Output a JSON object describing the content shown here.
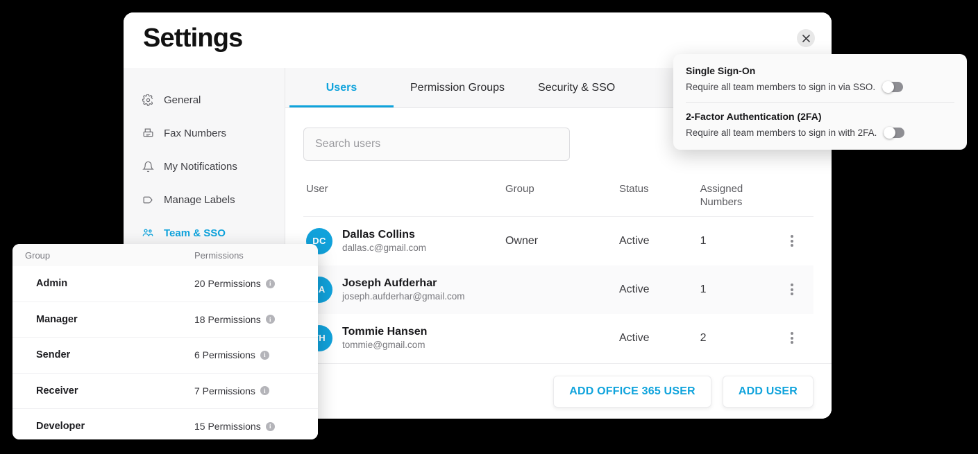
{
  "window": {
    "title": "Settings",
    "close_icon": "close-icon"
  },
  "sidebar": {
    "items": [
      {
        "label": "General",
        "icon": "gear-icon",
        "active": false
      },
      {
        "label": "Fax Numbers",
        "icon": "fax-icon",
        "active": false
      },
      {
        "label": "My Notifications",
        "icon": "bell-icon",
        "active": false
      },
      {
        "label": "Manage Labels",
        "icon": "tag-icon",
        "active": false
      },
      {
        "label": "Team & SSO",
        "icon": "people-icon",
        "active": true
      }
    ]
  },
  "tabs": [
    {
      "label": "Users",
      "active": true
    },
    {
      "label": "Permission Groups",
      "active": false
    },
    {
      "label": "Security & SSO",
      "active": false
    }
  ],
  "search": {
    "placeholder": "Search users",
    "value": ""
  },
  "users_table": {
    "columns": {
      "user": "User",
      "group": "Group",
      "status": "Status",
      "assigned_numbers_line1": "Assigned",
      "assigned_numbers_line2": "Numbers"
    },
    "rows": [
      {
        "initials": "DC",
        "name": "Dallas Collins",
        "email": "dallas.c@gmail.com",
        "group": "Owner",
        "status": "Active",
        "assigned_numbers": "1"
      },
      {
        "initials": "JA",
        "name": "Joseph Aufderhar",
        "email": "joseph.aufderhar@gmail.com",
        "group": "",
        "status": "Active",
        "assigned_numbers": "1"
      },
      {
        "initials": "TH",
        "name": "Tommie Hansen",
        "email": "tommie@gmail.com",
        "group": "",
        "status": "Active",
        "assigned_numbers": "2"
      }
    ]
  },
  "footer": {
    "add_office_365_user": "ADD OFFICE 365 USER",
    "add_user": "ADD USER"
  },
  "sso_popup": {
    "sso": {
      "title": "Single Sign-On",
      "description": "Require all team members to sign in via SSO.",
      "enabled": false
    },
    "twofa": {
      "title": "2-Factor Authentication (2FA)",
      "description": "Require all team members to sign in with 2FA.",
      "enabled": false
    }
  },
  "permissions_panel": {
    "columns": {
      "group": "Group",
      "permissions": "Permissions"
    },
    "rows": [
      {
        "group": "Admin",
        "permissions": "20 Permissions"
      },
      {
        "group": "Manager",
        "permissions": "18 Permissions"
      },
      {
        "group": "Sender",
        "permissions": "6 Permissions"
      },
      {
        "group": "Receiver",
        "permissions": "7 Permissions"
      },
      {
        "group": "Developer",
        "permissions": "15 Permissions"
      }
    ]
  },
  "colors": {
    "accent": "#0fa3dc",
    "avatar": "#11a2db",
    "panel_bg": "#fafafa",
    "sidebar_bg": "#f7f7f8"
  }
}
